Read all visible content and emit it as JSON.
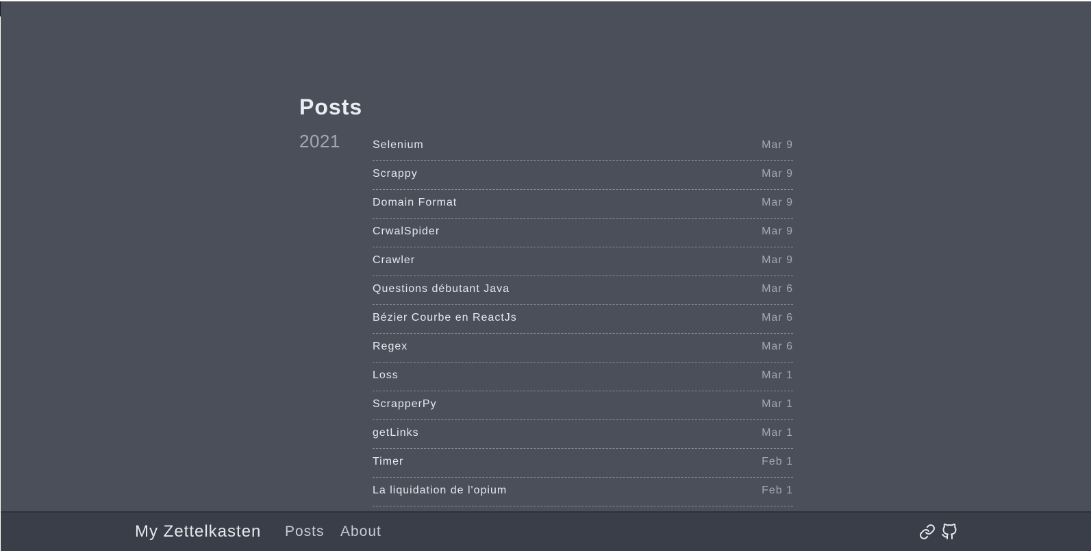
{
  "page": {
    "title": "Posts"
  },
  "archive": {
    "year": "2021",
    "posts": [
      {
        "title": "Selenium",
        "date": "Mar 9"
      },
      {
        "title": "Scrappy",
        "date": "Mar 9"
      },
      {
        "title": "Domain Format",
        "date": "Mar 9"
      },
      {
        "title": "CrwalSpider",
        "date": "Mar 9"
      },
      {
        "title": "Crawler",
        "date": "Mar 9"
      },
      {
        "title": "Questions débutant Java",
        "date": "Mar 6"
      },
      {
        "title": "Bézier Courbe en ReactJs",
        "date": "Mar 6"
      },
      {
        "title": "Regex",
        "date": "Mar 6"
      },
      {
        "title": "Loss",
        "date": "Mar 1"
      },
      {
        "title": "ScrapperPy",
        "date": "Mar 1"
      },
      {
        "title": "getLinks",
        "date": "Mar 1"
      },
      {
        "title": "Timer",
        "date": "Feb 1"
      },
      {
        "title": "La liquidation de l'opium",
        "date": "Feb 1"
      }
    ]
  },
  "footer": {
    "brand": "My Zettelkasten",
    "nav": [
      {
        "label": "Posts"
      },
      {
        "label": "About"
      }
    ],
    "icons": [
      {
        "name": "link-icon"
      },
      {
        "name": "github-icon"
      }
    ]
  },
  "colors": {
    "background": "#4a4f5a",
    "footer": "#3a3e48",
    "text": "#e6e8ee",
    "muted": "#a3a8b3"
  }
}
